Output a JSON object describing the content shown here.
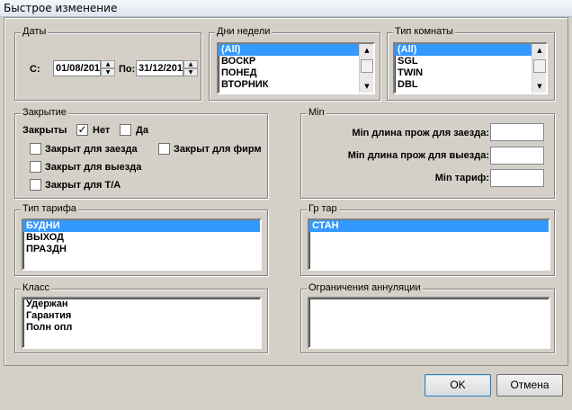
{
  "window": {
    "title": "Быстрое изменение"
  },
  "dates": {
    "legend": "Даты",
    "from_label": "С:",
    "from_value": "01/08/201",
    "to_label": "По:",
    "to_value": "31/12/201"
  },
  "weekdays": {
    "legend": "Дни недели",
    "items": [
      "(All)",
      "ВОСКР",
      "ПОНЕД",
      "ВТОРНИК"
    ],
    "selected": "(All)"
  },
  "room_type": {
    "legend": "Тип комнаты",
    "items": [
      "(All)",
      "SGL",
      "TWIN",
      "DBL"
    ],
    "selected": "(All)"
  },
  "closure": {
    "legend": "Закрытие",
    "closed_label": "Закрыты",
    "no_label": "Нет",
    "no_checked": true,
    "yes_label": "Да",
    "yes_checked": false,
    "closed_arrival": "Закрыт для заезда",
    "closed_firms": "Закрыт для фирм",
    "closed_departure": "Закрыт для выезда",
    "closed_ta": "Закрыт для Т/А"
  },
  "min": {
    "legend": "Min",
    "stay_arrival_label": "Min длина прож для заезда:",
    "stay_arrival_value": "",
    "stay_departure_label": "Min длина прож для выезда:",
    "stay_departure_value": "",
    "rate_label": "Min тариф:",
    "rate_value": ""
  },
  "rate_type": {
    "legend": "Тип тарифа",
    "items": [
      "БУДНИ",
      "ВЫХОД",
      "ПРАЗДН"
    ],
    "selected": "БУДНИ"
  },
  "rate_group": {
    "legend": "Гр тар",
    "items": [
      "СТАН"
    ],
    "selected": "СТАН"
  },
  "class": {
    "legend": "Класс",
    "items": [
      "Удержан",
      "Гарантия",
      "Полн опл"
    ]
  },
  "cancellation": {
    "legend": "Ограничения аннуляции",
    "items": []
  },
  "buttons": {
    "ok": "OK",
    "cancel": "Отмена"
  },
  "colors": {
    "selection": "#3399ff",
    "face": "#d4d0c8"
  }
}
